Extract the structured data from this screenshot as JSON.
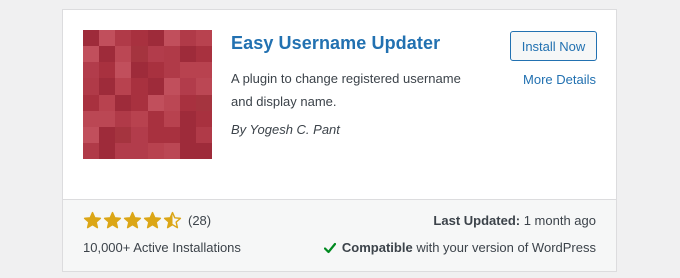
{
  "plugin": {
    "title": "Easy Username Updater",
    "install_label": "Install Now",
    "more_details_label": "More Details",
    "description": "A plugin to change registered username and display name.",
    "author": "By Yogesh C. Pant",
    "thumbnail_icon": "pixelated-red-thumbnail"
  },
  "footer": {
    "rating": 4.5,
    "rating_max": 5,
    "rating_count": "(28)",
    "active_installs": "10,000+ Active Installations",
    "last_updated_label": "Last Updated:",
    "last_updated_value": "1 month ago",
    "compatible_label": "Compatible",
    "compatible_text": "with your version of WordPress"
  },
  "colors": {
    "accent": "#2271b1",
    "star": "#dba617",
    "check": "#008a20",
    "thumbnail_base": "#b03a48"
  }
}
